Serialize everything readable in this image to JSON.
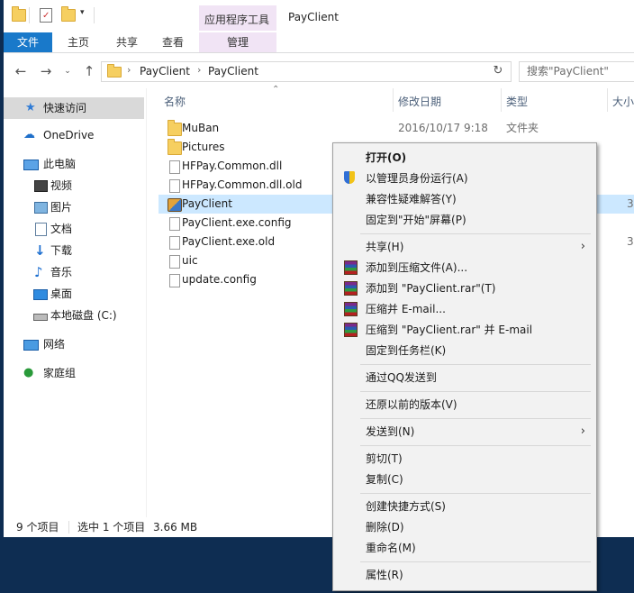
{
  "titlebar": {
    "context_tab_header": "应用程序工具",
    "window_title": "PayClient"
  },
  "ribbon": {
    "tabs": [
      "文件",
      "主页",
      "共享",
      "查看"
    ],
    "manage_tab": "管理"
  },
  "address": {
    "crumbs": [
      "PayClient",
      "PayClient"
    ],
    "search_placeholder": "搜索\"PayClient\""
  },
  "nav": {
    "items": [
      {
        "label": "快速访问",
        "icon": "star-icon"
      },
      {
        "label": "OneDrive",
        "icon": "cloud-icon"
      },
      {
        "label": "此电脑",
        "icon": "computer-icon"
      },
      {
        "label": "视频",
        "icon": "video-icon"
      },
      {
        "label": "图片",
        "icon": "picture-icon"
      },
      {
        "label": "文档",
        "icon": "document-icon"
      },
      {
        "label": "下载",
        "icon": "download-icon"
      },
      {
        "label": "音乐",
        "icon": "music-icon"
      },
      {
        "label": "桌面",
        "icon": "desktop-icon"
      },
      {
        "label": "本地磁盘 (C:)",
        "icon": "drive-icon"
      },
      {
        "label": "网络",
        "icon": "network-icon"
      },
      {
        "label": "家庭组",
        "icon": "homegroup-icon"
      }
    ]
  },
  "columns": {
    "name": "名称",
    "date": "修改日期",
    "type": "类型",
    "size": "大小"
  },
  "files": [
    {
      "name": "MuBan",
      "date": "2016/10/17 9:18",
      "type": "文件夹",
      "size": "",
      "icon": "folder-icon"
    },
    {
      "name": "Pictures",
      "date": "",
      "type": "",
      "size": "",
      "icon": "folder-icon"
    },
    {
      "name": "HFPay.Common.dll",
      "date": "",
      "type": "",
      "size": "",
      "icon": "dll-file-icon"
    },
    {
      "name": "HFPay.Common.dll.old",
      "date": "",
      "type": "",
      "size": "",
      "icon": "file-icon"
    },
    {
      "name": "PayClient",
      "date": "",
      "type": "",
      "size": "3",
      "icon": "app-icon"
    },
    {
      "name": "PayClient.exe.config",
      "date": "",
      "type": "",
      "size": "",
      "icon": "file-icon"
    },
    {
      "name": "PayClient.exe.old",
      "date": "",
      "type": "",
      "size": "3",
      "icon": "file-icon"
    },
    {
      "name": "uic",
      "date": "",
      "type": "",
      "size": "",
      "icon": "file-icon"
    },
    {
      "name": "update.config",
      "date": "",
      "type": "",
      "size": "",
      "icon": "file-icon"
    }
  ],
  "status": {
    "count": "9 个项目",
    "selected": "选中 1 个项目",
    "size": "3.66 MB"
  },
  "context_menu": {
    "items": [
      {
        "label": "打开(O)",
        "bold": true
      },
      {
        "label": "以管理员身份运行(A)",
        "icon": "shield-icon"
      },
      {
        "label": "兼容性疑难解答(Y)"
      },
      {
        "label": "固定到\"开始\"屏幕(P)"
      },
      {
        "label": "共享(H)",
        "submenu": true
      },
      {
        "label": "添加到压缩文件(A)...",
        "icon": "winrar-icon"
      },
      {
        "label": "添加到 \"PayClient.rar\"(T)",
        "icon": "winrar-icon"
      },
      {
        "label": "压缩并 E-mail...",
        "icon": "winrar-icon"
      },
      {
        "label": "压缩到 \"PayClient.rar\" 并 E-mail",
        "icon": "winrar-icon"
      },
      {
        "label": "固定到任务栏(K)"
      },
      {
        "label": "通过QQ发送到"
      },
      {
        "label": "还原以前的版本(V)"
      },
      {
        "label": "发送到(N)",
        "submenu": true
      },
      {
        "label": "剪切(T)"
      },
      {
        "label": "复制(C)"
      },
      {
        "label": "创建快捷方式(S)"
      },
      {
        "label": "删除(D)"
      },
      {
        "label": "重命名(M)"
      },
      {
        "label": "属性(R)"
      }
    ]
  }
}
